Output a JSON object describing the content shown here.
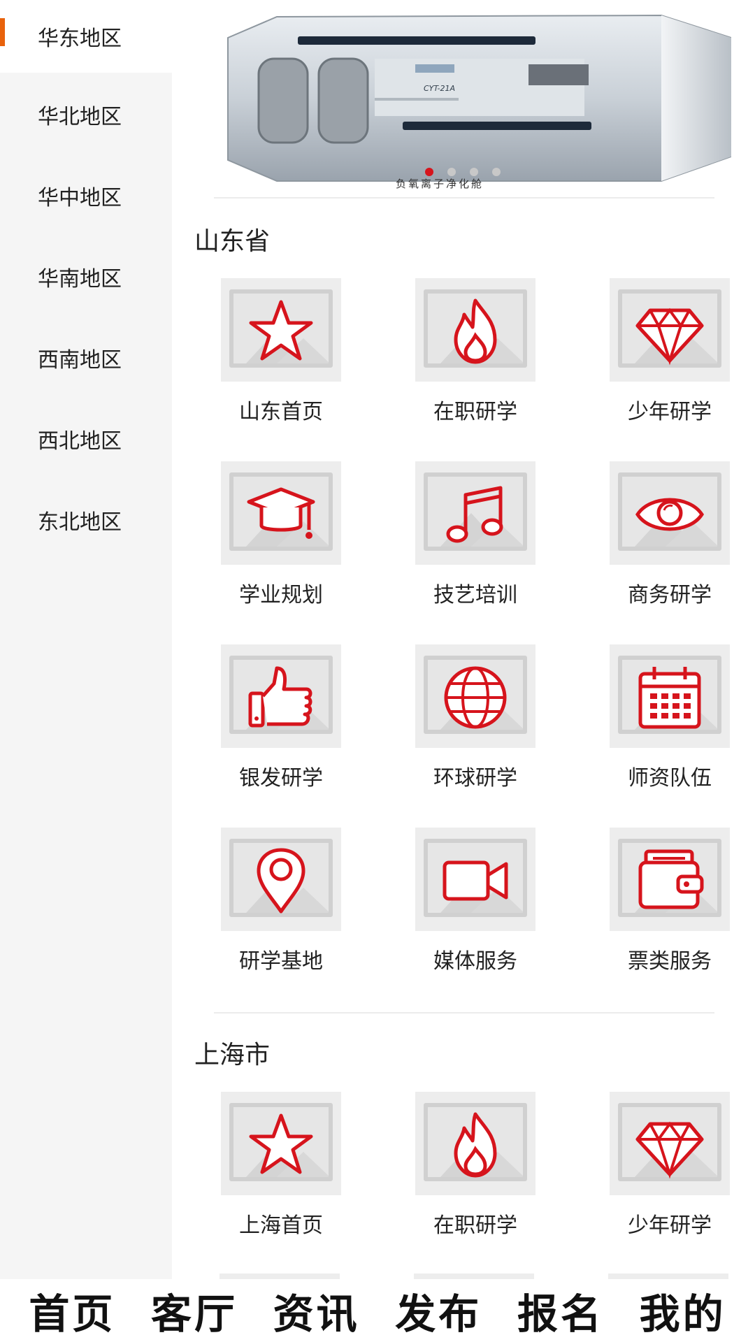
{
  "sidebar": {
    "items": [
      {
        "label": "华东地区",
        "active": true
      },
      {
        "label": "华北地区"
      },
      {
        "label": "华中地区"
      },
      {
        "label": "华南地区"
      },
      {
        "label": "西南地区"
      },
      {
        "label": "西北地区"
      },
      {
        "label": "东北地区"
      }
    ]
  },
  "banner": {
    "caption": "负氧离子净化舱",
    "model": "CYT-21A",
    "slide_count": 4,
    "active_slide": 1
  },
  "sections": [
    {
      "title": "山东省",
      "tiles": [
        {
          "label": "山东首页",
          "icon": "star-icon"
        },
        {
          "label": "在职研学",
          "icon": "fire-icon"
        },
        {
          "label": "少年研学",
          "icon": "diamond-icon"
        },
        {
          "label": "学业规划",
          "icon": "graduation-cap-icon"
        },
        {
          "label": "技艺培训",
          "icon": "music-note-icon"
        },
        {
          "label": "商务研学",
          "icon": "eye-icon"
        },
        {
          "label": "银发研学",
          "icon": "thumbs-up-icon"
        },
        {
          "label": "环球研学",
          "icon": "globe-icon"
        },
        {
          "label": "师资队伍",
          "icon": "calendar-icon"
        },
        {
          "label": "研学基地",
          "icon": "map-pin-icon"
        },
        {
          "label": "媒体服务",
          "icon": "video-camera-icon"
        },
        {
          "label": "票类服务",
          "icon": "wallet-icon"
        }
      ]
    },
    {
      "title": "上海市",
      "tiles": [
        {
          "label": "上海首页",
          "icon": "star-icon"
        },
        {
          "label": "在职研学",
          "icon": "fire-icon"
        },
        {
          "label": "少年研学",
          "icon": "diamond-icon"
        }
      ]
    }
  ],
  "tabbar": {
    "items": [
      {
        "label": "首页"
      },
      {
        "label": "客厅"
      },
      {
        "label": "资讯"
      },
      {
        "label": "发布"
      },
      {
        "label": "报名"
      },
      {
        "label": "我的"
      }
    ]
  },
  "colors": {
    "accent": "#e8620c",
    "icon_red": "#d6141c",
    "sidebar_bg": "#f5f5f5"
  }
}
